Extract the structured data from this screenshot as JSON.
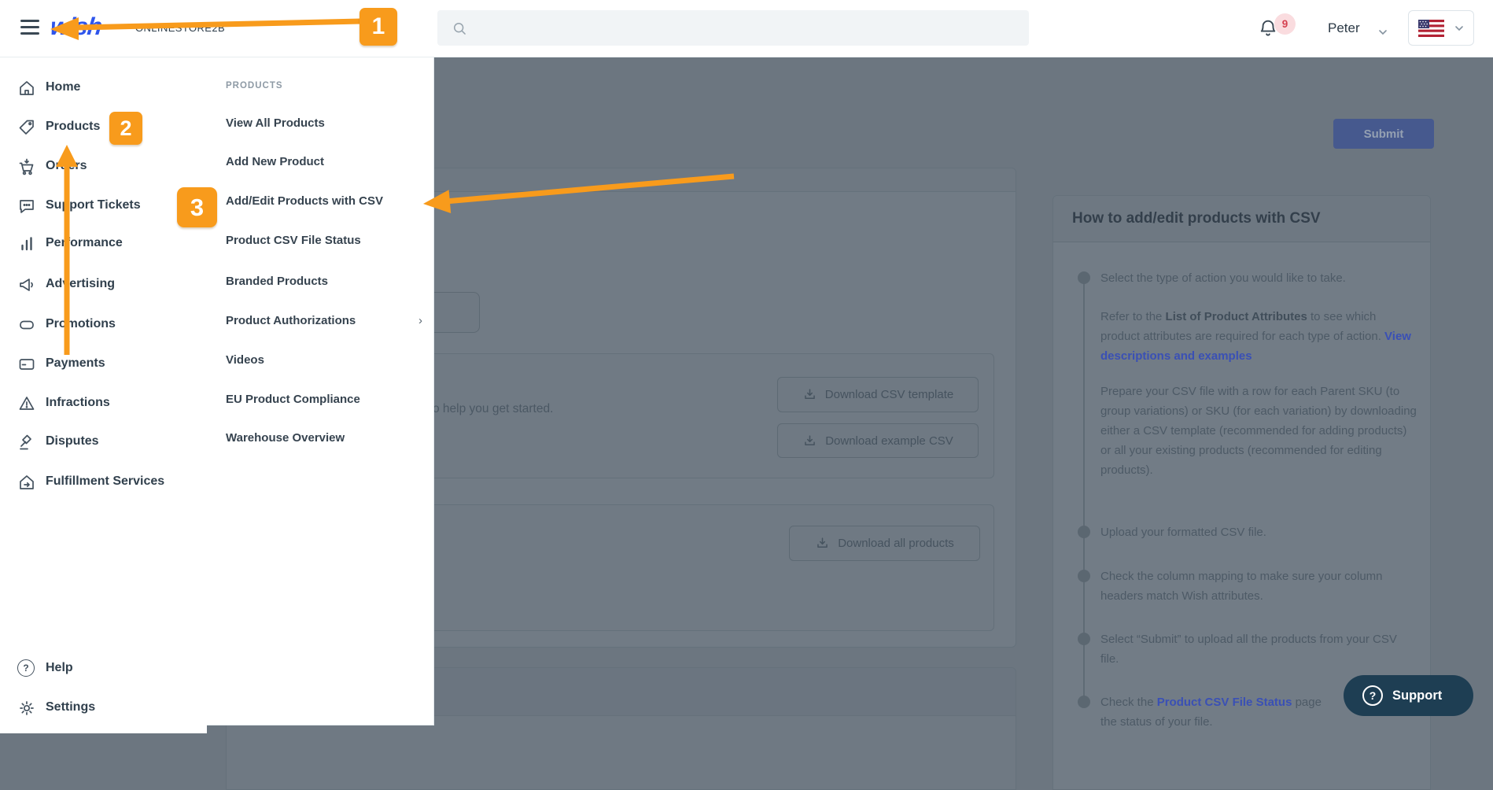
{
  "topbar": {
    "logo": "wish",
    "store_name": "ONLINESTORE2B",
    "search_placeholder": "",
    "user_name": "Peter",
    "notification_count": "9"
  },
  "sidebar": {
    "items": [
      {
        "label": "Home",
        "icon": "home-icon"
      },
      {
        "label": "Products",
        "icon": "tag-icon"
      },
      {
        "label": "Orders",
        "icon": "cart-icon"
      },
      {
        "label": "Support Tickets",
        "icon": "chat-icon"
      },
      {
        "label": "Performance",
        "icon": "bar-chart-icon"
      },
      {
        "label": "Advertising",
        "icon": "megaphone-icon"
      },
      {
        "label": "Promotions",
        "icon": "coupon-icon"
      },
      {
        "label": "Payments",
        "icon": "credit-card-icon"
      },
      {
        "label": "Infractions",
        "icon": "warning-triangle-icon"
      },
      {
        "label": "Disputes",
        "icon": "gavel-icon"
      },
      {
        "label": "Fulfillment Services",
        "icon": "fulfillment-icon"
      }
    ],
    "footer_items": [
      {
        "label": "Help",
        "icon": "question-circle-icon",
        "glyph": "?"
      },
      {
        "label": "Settings",
        "icon": "gear-icon"
      }
    ]
  },
  "submenu": {
    "header": "PRODUCTS",
    "items": [
      {
        "label": "View All Products"
      },
      {
        "label": "Add New Product"
      },
      {
        "label": "Add/Edit Products with CSV"
      },
      {
        "label": "Product CSV File Status"
      },
      {
        "label": "Branded Products"
      },
      {
        "label": "Product Authorizations",
        "chevron": "›"
      },
      {
        "label": "Videos"
      },
      {
        "label": "EU Product Compliance"
      },
      {
        "label": "Warehouse Overview"
      }
    ]
  },
  "main": {
    "submit_label": "Submit",
    "helper_text_visible": "o help you get started.",
    "download_template_label": "Download CSV template",
    "download_example_label": "Download example CSV",
    "download_all_label": "Download all products"
  },
  "help_panel": {
    "title": "How to add/edit products with CSV",
    "step1": "Select the type of action you would like to take.",
    "p1_pre": "Refer to the ",
    "p1_bold": "List of Product Attributes",
    "p1_mid": " to see which product attributes are required for each type of action. ",
    "p1_link": "View descriptions and examples",
    "p2": "Prepare your CSV file with a row for each Parent SKU (to group variations) or SKU (for each variation) by downloading either a CSV template (recommended for adding products) or all your existing products (recommended for editing products).",
    "step2": "Upload your formatted CSV file.",
    "step3": "Check the column mapping to make sure your column headers match Wish attributes.",
    "step4": "Select “Submit” to upload all the products from your CSV file.",
    "step5_pre": "Check the ",
    "step5_link": "Product CSV File Status",
    "step5_post": " page",
    "step5_line2": "the status of your file."
  },
  "support": {
    "label": "Support",
    "icon_glyph": "?"
  },
  "annotations": {
    "badge1": "1",
    "badge2": "2",
    "badge3": "3"
  },
  "colors": {
    "annotation_orange": "#F89B1C",
    "wish_blue": "#2E55EC",
    "link_blue": "#3A50B5",
    "submit_blue": "#46598E",
    "support_navy": "#1E3E53",
    "notification_red": "#D54150"
  }
}
